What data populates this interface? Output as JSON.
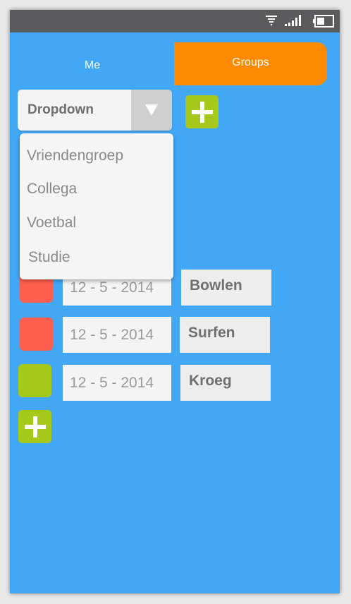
{
  "tabs": {
    "me": "Me",
    "groups": "Groups"
  },
  "dropdown": {
    "selected": "Dropdown",
    "options": [
      "Vriendengroep",
      "Collega",
      "Voetbal",
      "Studie"
    ]
  },
  "events": [
    {
      "date": "12 - 5 - 2014",
      "name": "Bowlen",
      "color": "#ff5f4e"
    },
    {
      "date": "12 - 5 - 2014",
      "name": "Surfen",
      "color": "#ff5f4e"
    },
    {
      "date": "12 - 5 - 2014",
      "name": "Kroeg",
      "color": "#a6c81a"
    }
  ],
  "colors": {
    "background": "#42a8f5",
    "accent": "#ff8a00",
    "add_button": "#a6c81a",
    "statusbar": "#5b5b5e"
  },
  "icons": [
    "wifi-icon",
    "signal-icon",
    "battery-icon",
    "chevron-down-icon",
    "plus-icon"
  ]
}
